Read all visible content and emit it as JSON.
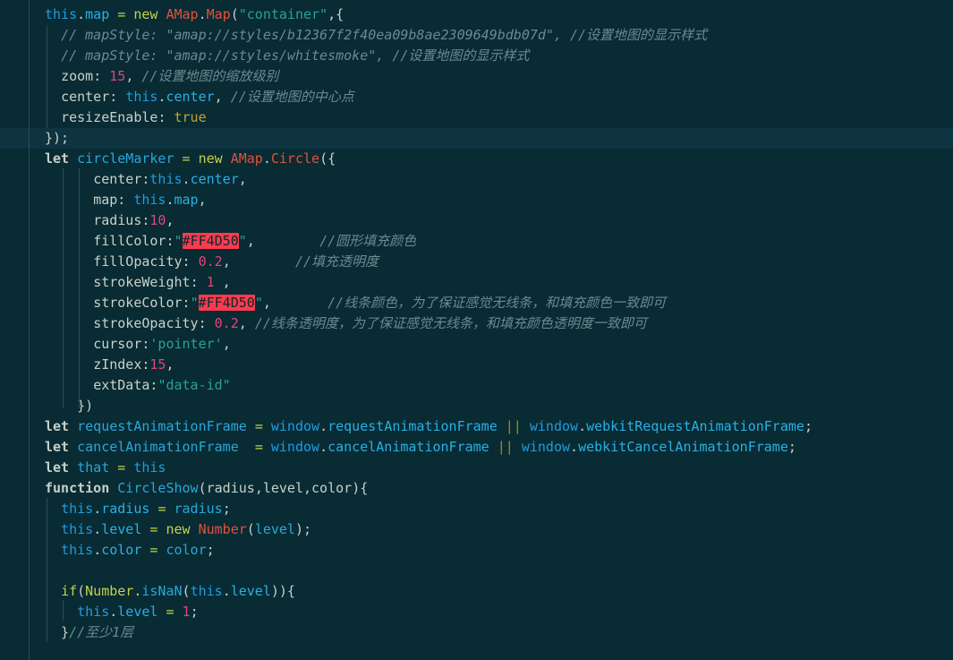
{
  "editor": {
    "lines": [
      {
        "text": "this.map = new AMap.Map(\"container\",{"
      },
      {
        "text": "  // mapStyle: \"amap://styles/b12367f2f40ea09b8ae2309649bdb07d\", //设置地图的显示样式"
      },
      {
        "text": "  // mapStyle: \"amap://styles/whitesmoke\", //设置地图的显示样式"
      },
      {
        "text": "  zoom: 15, //设置地图的缩放级别"
      },
      {
        "text": "  center: this.center, //设置地图的中心点"
      },
      {
        "text": "  resizeEnable: true"
      },
      {
        "text": "});"
      },
      {
        "text": "let circleMarker = new AMap.Circle({"
      },
      {
        "text": "      center:this.center,"
      },
      {
        "text": "      map: this.map,"
      },
      {
        "text": "      radius:10,"
      },
      {
        "text": "      fillColor:\"#FF4D50\",        //圆形填充颜色"
      },
      {
        "text": "      fillOpacity: 0.2,        //填充透明度"
      },
      {
        "text": "      strokeWeight: 1 ,"
      },
      {
        "text": "      strokeColor:\"#FF4D50\",       //线条颜色，为了保证感觉无线条，和填充颜色一致即可"
      },
      {
        "text": "      strokeOpacity: 0.2, //线条透明度，为了保证感觉无线条，和填充颜色透明度一致即可"
      },
      {
        "text": "      cursor:'pointer',"
      },
      {
        "text": "      zIndex:15,"
      },
      {
        "text": "      extData:\"data-id\""
      },
      {
        "text": "    })"
      },
      {
        "text": "let requestAnimationFrame = window.requestAnimationFrame || window.webkitRequestAnimationFrame;"
      },
      {
        "text": "let cancelAnimationFrame  = window.cancelAnimationFrame || window.webkitCancelAnimationFrame;"
      },
      {
        "text": "let that = this"
      },
      {
        "text": "function CircleShow(radius,level,color){"
      },
      {
        "text": "  this.radius = radius;"
      },
      {
        "text": "  this.level = new Number(level);"
      },
      {
        "text": "  this.color = color;"
      },
      {
        "text": ""
      },
      {
        "text": "  if(Number.isNaN(this.level)){"
      },
      {
        "text": "    this.level = 1;"
      },
      {
        "text": "  }//至少1层"
      }
    ]
  },
  "theme": {
    "background": "#082b34",
    "current_line": "#0d3440",
    "color_highlight": "#fb3b4d"
  }
}
